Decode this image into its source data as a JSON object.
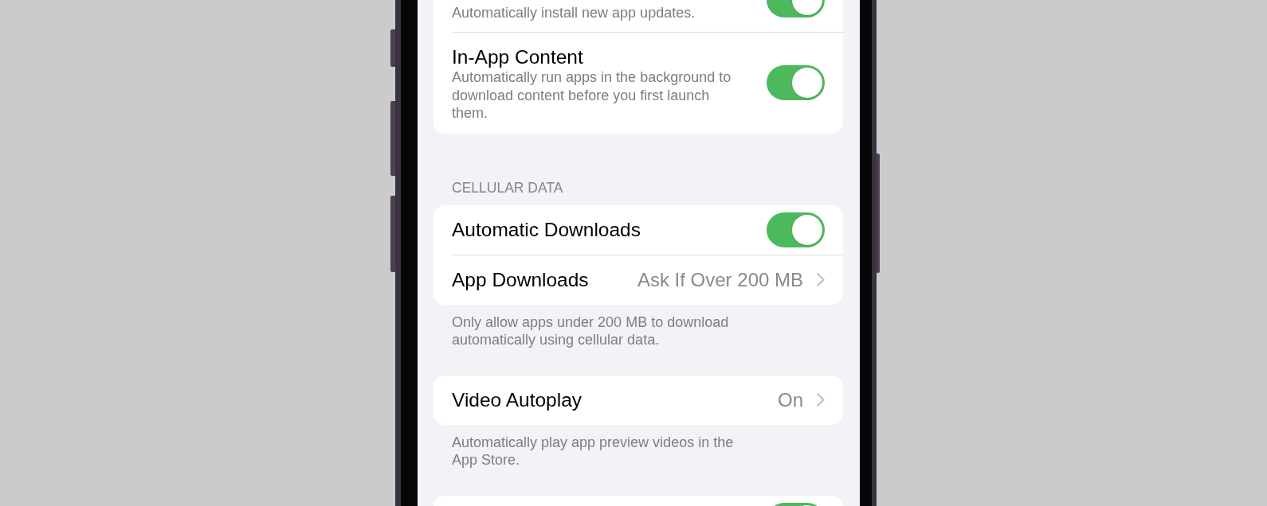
{
  "sections": [
    {
      "rows": [
        {
          "kind": "toggle",
          "subtitle": "Automatically install new app updates.",
          "on": true
        },
        {
          "kind": "toggle",
          "title": "In-App Content",
          "subtitle": "Automatically run apps in the background to download content before you first launch them.",
          "on": true
        }
      ]
    },
    {
      "header": "CELLULAR DATA",
      "rows": [
        {
          "kind": "toggle",
          "title": "Automatic Downloads",
          "on": true
        },
        {
          "kind": "link",
          "title": "App Downloads",
          "value": "Ask If Over 200 MB"
        }
      ],
      "footer": "Only allow apps under 200 MB to download automatically using cellular data."
    },
    {
      "rows": [
        {
          "kind": "link",
          "title": "Video Autoplay",
          "value": "On"
        }
      ],
      "footer": "Automatically play app preview videos in the App Store."
    },
    {
      "rows": [
        {
          "kind": "toggle",
          "on": true
        }
      ]
    }
  ]
}
